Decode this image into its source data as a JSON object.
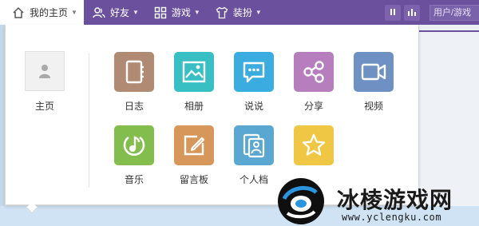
{
  "nav": {
    "items": [
      {
        "label": "我的主页",
        "icon": "home-icon",
        "active": true
      },
      {
        "label": "好友",
        "icon": "friends-icon",
        "active": false
      },
      {
        "label": "游戏",
        "icon": "games-grid-icon",
        "active": false
      },
      {
        "label": "装扮",
        "icon": "tshirt-icon",
        "active": false
      }
    ],
    "search_placeholder": "用户/游戏",
    "colors": {
      "bar": "#6b519d"
    }
  },
  "menu": {
    "home_label": "主页",
    "apps": [
      {
        "label": "日志",
        "icon": "notebook-icon",
        "color": "#b18a74"
      },
      {
        "label": "相册",
        "icon": "photo-icon",
        "color": "#38bfc4"
      },
      {
        "label": "说说",
        "icon": "chat-bubble-icon",
        "color": "#3bace0"
      },
      {
        "label": "分享",
        "icon": "share-icon",
        "color": "#b77ebd"
      },
      {
        "label": "视频",
        "icon": "video-camera-icon",
        "color": "#6e90c2"
      },
      {
        "label": "音乐",
        "icon": "music-note-icon",
        "color": "#82bd4e"
      },
      {
        "label": "留言板",
        "icon": "pencil-board-icon",
        "color": "#d7975a"
      },
      {
        "label": "个人档",
        "icon": "profile-card-icon",
        "color": "#5aa7d1"
      },
      {
        "label": "",
        "icon": "star-icon",
        "color": "#efc745"
      }
    ]
  },
  "watermark": {
    "name": "冰棱游戏网",
    "url": "www.yclengku.com"
  }
}
